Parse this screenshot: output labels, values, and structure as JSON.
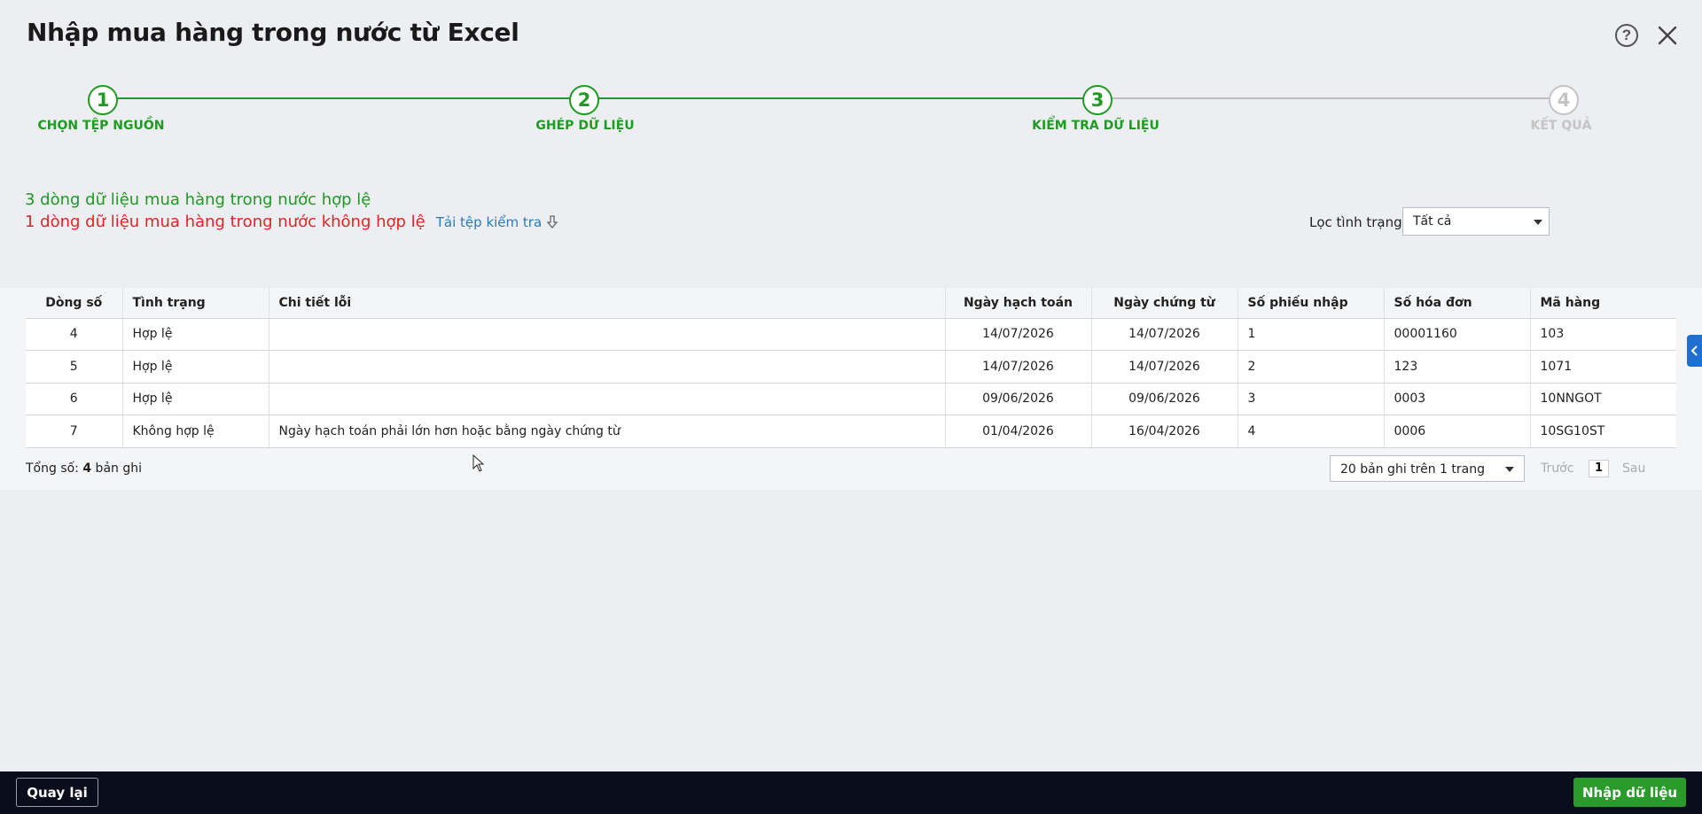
{
  "dialog": {
    "title": "Nhập mua hàng trong nước từ Excel",
    "help_glyph": "?"
  },
  "stepper": {
    "steps": [
      {
        "number": "1",
        "label": "Chọn tệp nguồn",
        "state": "done"
      },
      {
        "number": "2",
        "label": "Ghép dữ liệu",
        "state": "done"
      },
      {
        "number": "3",
        "label": "Kiểm tra dữ liệu",
        "state": "done"
      },
      {
        "number": "4",
        "label": "Kết quả",
        "state": "todo"
      }
    ]
  },
  "summary": {
    "valid_text": "3 dòng dữ liệu mua hàng trong nước hợp lệ",
    "invalid_text": "1 dòng dữ liệu mua hàng trong nước không hợp lệ",
    "download_link": "Tải tệp kiểm tra"
  },
  "filter": {
    "label": "Lọc tình trạng",
    "selected": "Tất cả"
  },
  "table": {
    "columns": [
      "Dòng số",
      "Tình trạng",
      "Chi tiết lỗi",
      "Ngày hạch toán",
      "Ngày chứng từ",
      "Số phiếu nhập",
      "Số hóa đơn",
      "Mã hàng"
    ],
    "rows": [
      {
        "line": "4",
        "status": "Hợp lệ",
        "status_kind": "ok",
        "error": "",
        "posting_date": "14/07/2026",
        "doc_date": "14/07/2026",
        "receipt_no": "1",
        "invoice_no": "00001160",
        "item_code": "103"
      },
      {
        "line": "5",
        "status": "Hợp lệ",
        "status_kind": "ok",
        "error": "",
        "posting_date": "14/07/2026",
        "doc_date": "14/07/2026",
        "receipt_no": "2",
        "invoice_no": "123",
        "item_code": "1071"
      },
      {
        "line": "6",
        "status": "Hợp lệ",
        "status_kind": "ok",
        "error": "",
        "posting_date": "09/06/2026",
        "doc_date": "09/06/2026",
        "receipt_no": "3",
        "invoice_no": "0003",
        "item_code": "10NNGOT"
      },
      {
        "line": "7",
        "status": "Không hợp lệ",
        "status_kind": "bad",
        "error": "Ngày hạch toán phải lớn hơn hoặc bằng ngày chứng từ",
        "posting_date": "01/04/2026",
        "doc_date": "16/04/2026",
        "receipt_no": "4",
        "invoice_no": "0006",
        "item_code": "10SG10ST"
      }
    ]
  },
  "pagination": {
    "total_prefix": "Tổng số: ",
    "total_count": "4",
    "total_suffix": " bản ghi",
    "page_size": "20 bản ghi trên 1 trang",
    "prev": "Trước",
    "current_page": "1",
    "next": "Sau"
  },
  "footer": {
    "back_label": "Quay lại",
    "import_label": "Nhập dữ liệu"
  },
  "colors": {
    "success": "#1f9a22",
    "error": "#e52222",
    "link": "#2c7ab8",
    "footer_bg": "#0a0d1c",
    "primary_button": "#2a9b2a"
  }
}
